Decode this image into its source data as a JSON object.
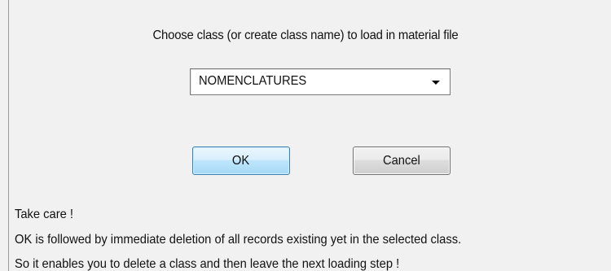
{
  "dialog": {
    "prompt": "Choose class (or create class name)  to load in material file",
    "class_select": {
      "selected": "NOMENCLATURES"
    },
    "buttons": {
      "ok_label": "OK",
      "cancel_label": "Cancel"
    },
    "warning": {
      "line1": "Take care !",
      "line2": "OK is followed by immediate deletion of all records existing yet in the selected class.",
      "line3": "So it enables you to delete a class and then leave the next loading step !"
    }
  },
  "colors": {
    "dialog_background": "#f1f1f1",
    "ok_button_border": "#3c7fb1",
    "ok_button_fill": "#bee6fd"
  },
  "icons": {
    "combo_arrow": "chevron-down-icon"
  }
}
